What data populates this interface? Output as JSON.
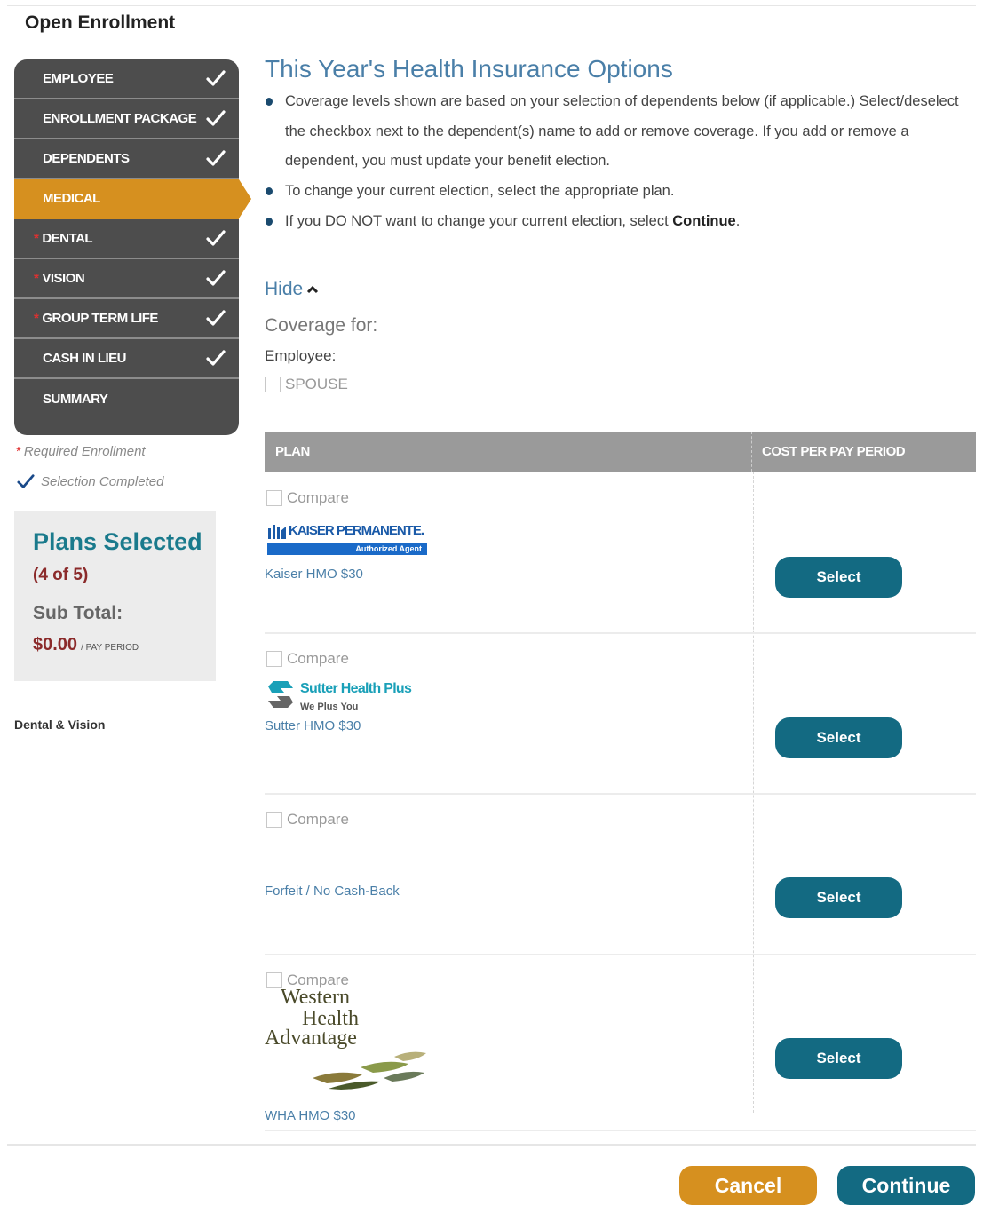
{
  "page_title": "Open Enrollment",
  "nav": [
    {
      "label": "EMPLOYEE",
      "required": false,
      "completed": true,
      "active": false
    },
    {
      "label": "ENROLLMENT PACKAGE",
      "required": false,
      "completed": true,
      "active": false
    },
    {
      "label": "DEPENDENTS",
      "required": false,
      "completed": true,
      "active": false
    },
    {
      "label": "MEDICAL",
      "required": false,
      "completed": false,
      "active": true
    },
    {
      "label": "DENTAL",
      "required": true,
      "completed": true,
      "active": false
    },
    {
      "label": "VISION",
      "required": true,
      "completed": true,
      "active": false
    },
    {
      "label": "GROUP TERM LIFE",
      "required": true,
      "completed": true,
      "active": false
    },
    {
      "label": "CASH IN LIEU",
      "required": false,
      "completed": true,
      "active": false
    },
    {
      "label": "SUMMARY",
      "required": false,
      "completed": false,
      "active": false
    }
  ],
  "legend": {
    "required_star": "*",
    "required": "Required Enrollment",
    "completed": "Selection Completed"
  },
  "summary": {
    "title": "Plans Selected",
    "count": "(4 of 5)",
    "subtotal_label": "Sub Total:",
    "subtotal_value": "$0.00",
    "per_period": "/ PAY PERIOD"
  },
  "sidebar_footer": "Dental & Vision",
  "main": {
    "title": "This Year's Health Insurance Options",
    "bullets": [
      "Coverage levels shown are based on your selection of dependents below (if applicable.) Select/deselect the checkbox next to the dependent(s) name to add or remove coverage. If you add or remove a dependent, you must update your benefit election.",
      "To change your current election, select the appropriate plan.",
      "If you DO NOT want to change your current election, select"
    ],
    "bullet_bold": "Continue",
    "bullet_end": ".",
    "hide_label": "Hide",
    "coverage_for": "Coverage for:",
    "employee_label": "Employee:",
    "spouse_label": "SPOUSE"
  },
  "table": {
    "col_plan": "PLAN",
    "col_cost": "COST PER PAY PERIOD",
    "compare_label": "Compare",
    "select_label": "Select",
    "plans": [
      {
        "name": "Kaiser HMO $30",
        "logo": "kaiser-permanente-logo",
        "logo_text": "KAISER PERMANENTE.",
        "logo_sub": "Authorized Agent"
      },
      {
        "name": "Sutter HMO $30",
        "logo": "sutter-health-plus-logo",
        "logo_text": "Sutter Health Plus",
        "logo_sub": "We Plus You"
      },
      {
        "name": "Forfeit / No Cash-Back",
        "logo": "none"
      },
      {
        "name": "WHA HMO $30",
        "logo": "western-health-advantage-logo",
        "logo_lines": [
          "Western",
          "Health",
          "Advantage"
        ]
      }
    ]
  },
  "footer": {
    "cancel": "Cancel",
    "continue": "Continue"
  },
  "colors": {
    "nav_bg": "#4d4d4d",
    "active": "#d6901f",
    "primary_button": "#136a82",
    "link": "#4a7fa8",
    "required_star": "#e03030",
    "subtotal": "#8b2a2a"
  }
}
